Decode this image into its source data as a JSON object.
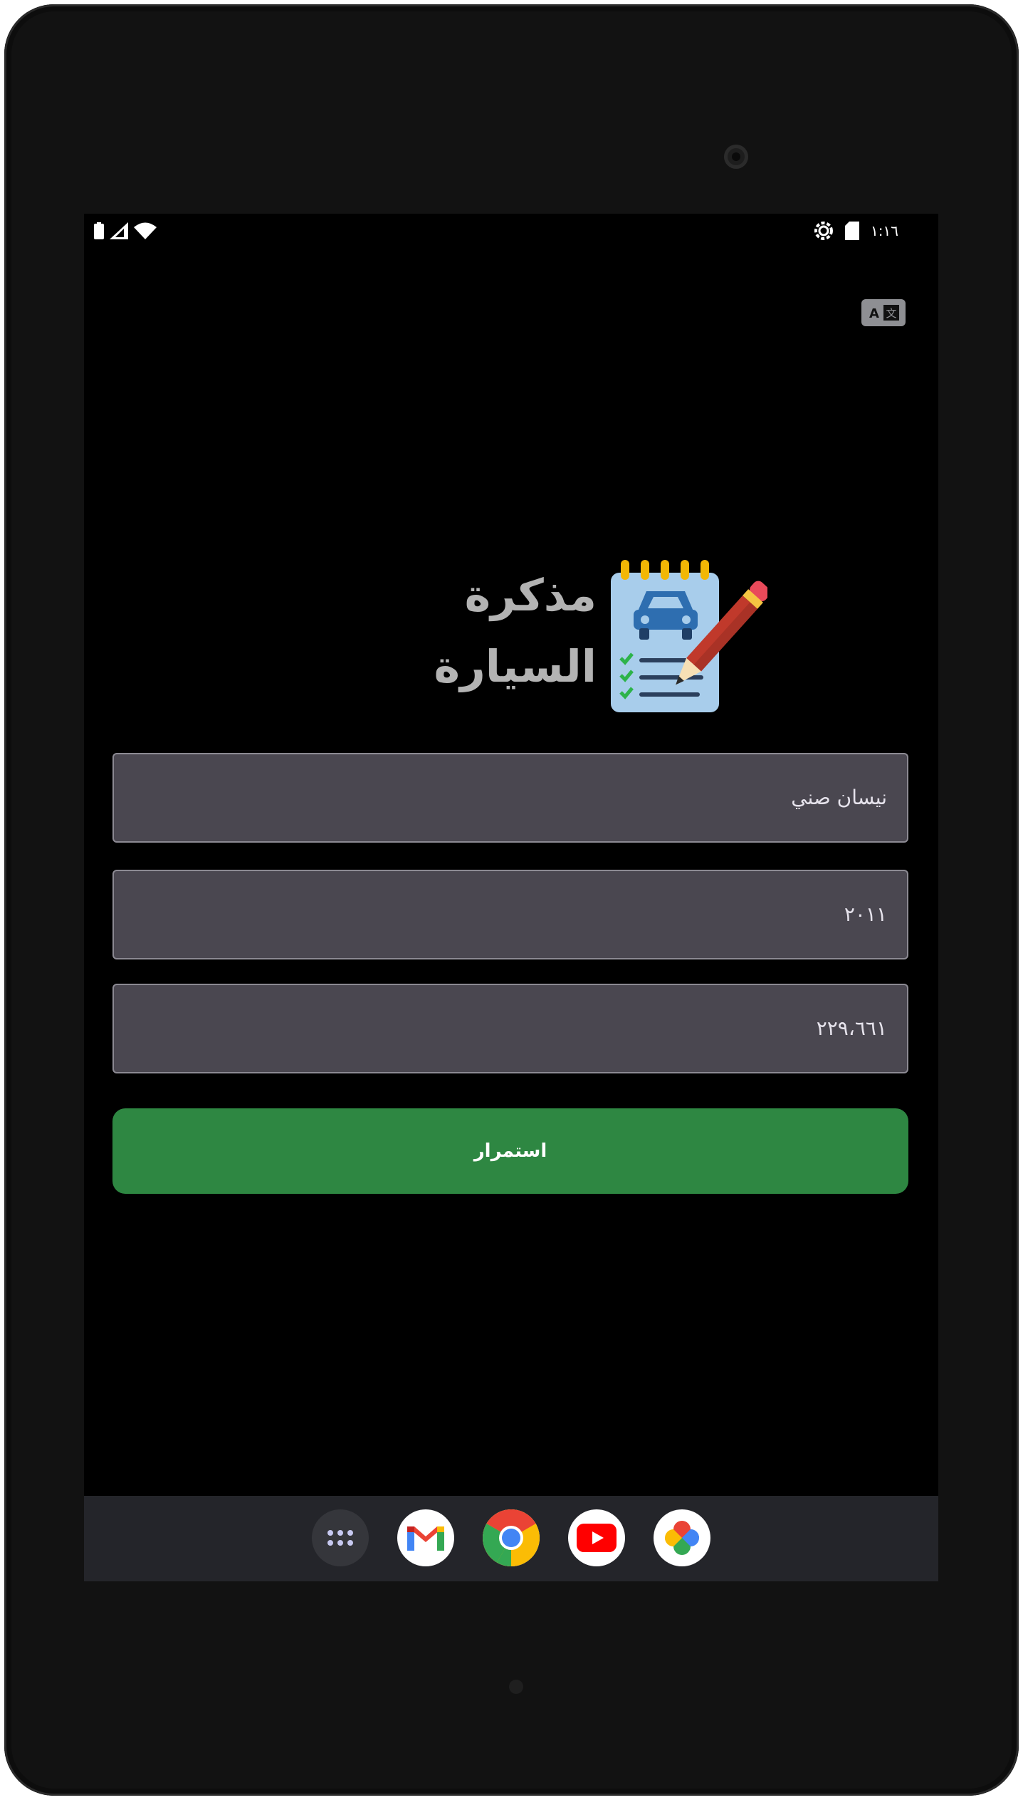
{
  "status_bar": {
    "time": "١:١٦",
    "left_icons": [
      "battery-icon",
      "signal-icon",
      "wifi-icon"
    ],
    "right_icons": [
      "settings-icon",
      "sd-card-icon"
    ]
  },
  "toolbar": {
    "translate_icon": "translate-icon"
  },
  "app": {
    "title_line1": "مذكرة",
    "title_line2": "السيارة",
    "logo_icon": "car-notepad-icon"
  },
  "form": {
    "car_model_value": "نيسان صني",
    "year_value": "٢٠١١",
    "mileage_value": "٢٢٩،٦٦١",
    "continue_label": "استمرار"
  },
  "dock": {
    "apps": [
      "all-apps-icon",
      "gmail-icon",
      "chrome-icon",
      "youtube-icon",
      "photos-icon"
    ]
  },
  "colors": {
    "field_bg": "#4a4750",
    "button_green": "#2e8742",
    "title_gray": "#b3b3b3",
    "nav_bg": "#24252a"
  }
}
